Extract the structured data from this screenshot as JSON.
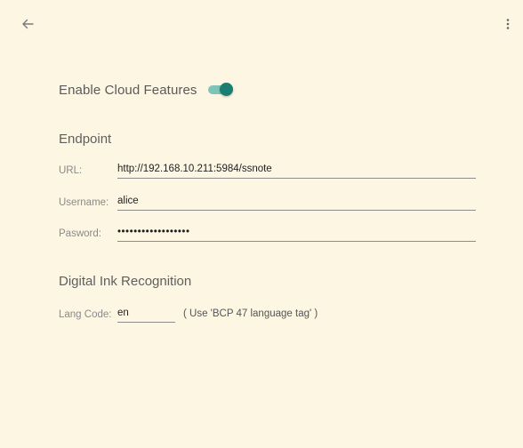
{
  "colors": {
    "background": "#fdf6e3",
    "accent": "#1a7f72",
    "accent_track": "#7fc4b8"
  },
  "topbar": {
    "back_icon": "arrow-left-icon",
    "menu_icon": "more-vertical-icon"
  },
  "cloud": {
    "label": "Enable Cloud Features",
    "enabled": true
  },
  "endpoint": {
    "title": "Endpoint",
    "url_label": "URL:",
    "url_value": "http://192.168.10.211:5984/ssnote",
    "username_label": "Username:",
    "username_value": "alice",
    "password_label": "Pasword:",
    "password_value": "••••••••••••••••••"
  },
  "ink": {
    "title": "Digital Ink Recognition",
    "lang_label": "Lang Code:",
    "lang_value": "en",
    "lang_hint": "( Use 'BCP 47 language tag' )"
  }
}
